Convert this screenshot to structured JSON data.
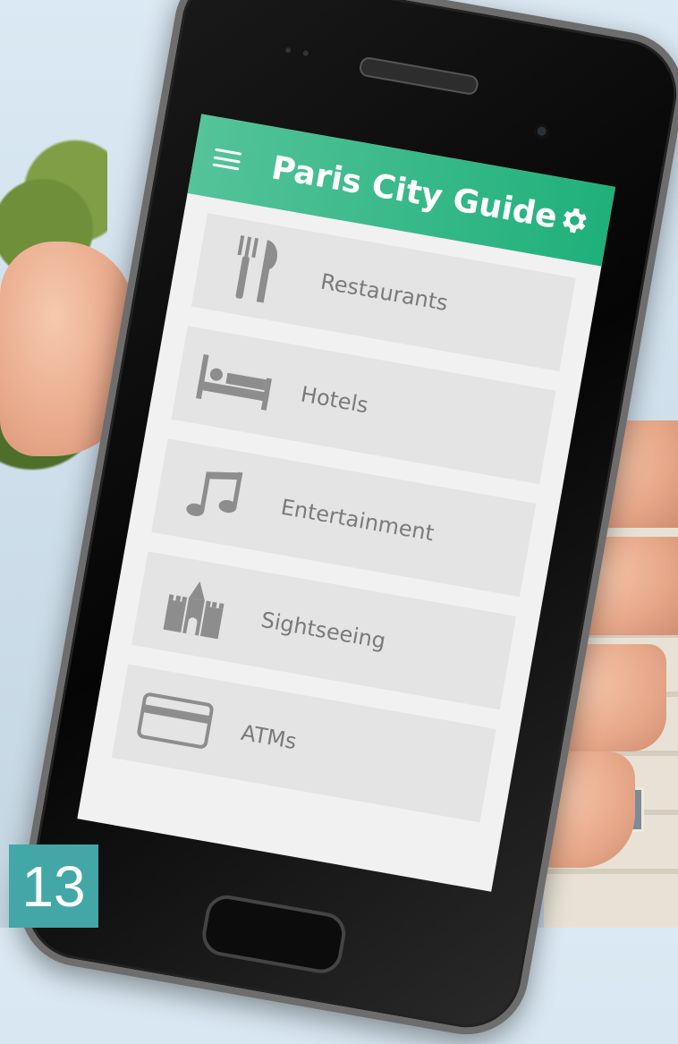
{
  "app": {
    "title": "Paris City Guide"
  },
  "menu": {
    "items": [
      {
        "label": "Restaurants",
        "icon": "fork-knife-icon"
      },
      {
        "label": "Hotels",
        "icon": "bed-icon"
      },
      {
        "label": "Entertainment",
        "icon": "music-note-icon"
      },
      {
        "label": "Sightseeing",
        "icon": "castle-icon"
      },
      {
        "label": "ATMs",
        "icon": "credit-card-icon"
      }
    ]
  },
  "badge": {
    "number": "13"
  },
  "colors": {
    "accent": "#1fb07a",
    "badge": "#43a7a8",
    "icon": "#8d8d8d"
  }
}
